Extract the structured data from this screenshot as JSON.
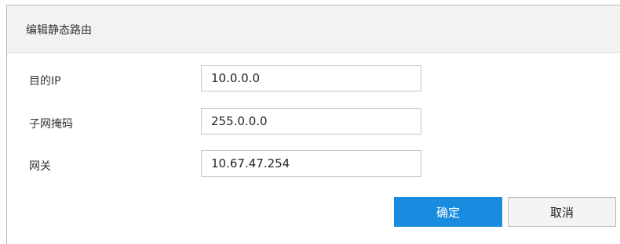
{
  "dialog": {
    "title": "编辑静态路由"
  },
  "form": {
    "dest_ip": {
      "label": "目的IP",
      "value": "10.0.0.0"
    },
    "subnet_mask": {
      "label": "子网掩码",
      "value": "255.0.0.0"
    },
    "gateway": {
      "label": "网关",
      "value": "10.67.47.254"
    }
  },
  "buttons": {
    "confirm_label": "确定",
    "cancel_label": "取消"
  },
  "colors": {
    "primary": "#1a8ce0",
    "header_bg": "#f2f2f2"
  }
}
